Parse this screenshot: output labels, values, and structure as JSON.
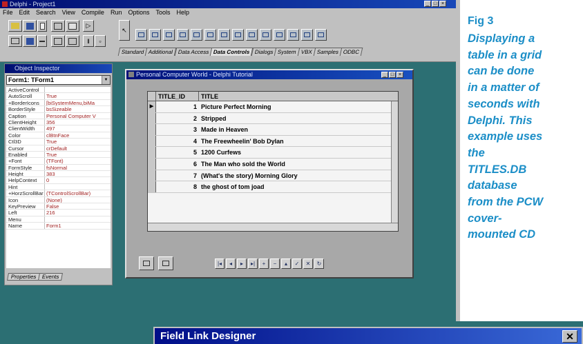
{
  "ide": {
    "title": "Delphi - Project1",
    "menu": [
      "File",
      "Edit",
      "Search",
      "View",
      "Compile",
      "Run",
      "Options",
      "Tools",
      "Help"
    ],
    "palette_tabs": [
      "Standard",
      "Additional",
      "Data Access",
      "Data Controls",
      "Dialogs",
      "System",
      "VBX",
      "Samples",
      "ODBC"
    ],
    "active_tab": "Data Controls"
  },
  "object_inspector": {
    "title": "Object Inspector",
    "combo_value": "Form1: TForm1",
    "properties": [
      {
        "k": "ActiveControl",
        "v": ""
      },
      {
        "k": "AutoScroll",
        "v": "True"
      },
      {
        "k": "+BorderIcons",
        "v": "[biSystemMenu,biMa"
      },
      {
        "k": "BorderStyle",
        "v": "bsSizeable"
      },
      {
        "k": "Caption",
        "v": "Personal Computer V"
      },
      {
        "k": "ClientHeight",
        "v": "356"
      },
      {
        "k": "ClientWidth",
        "v": "497"
      },
      {
        "k": "Color",
        "v": "clBtnFace"
      },
      {
        "k": "Ctl3D",
        "v": "True"
      },
      {
        "k": "Cursor",
        "v": "crDefault"
      },
      {
        "k": "Enabled",
        "v": "True"
      },
      {
        "k": "+Font",
        "v": "(TFont)"
      },
      {
        "k": "FormStyle",
        "v": "fsNormal"
      },
      {
        "k": "Height",
        "v": "383"
      },
      {
        "k": "HelpContext",
        "v": "0"
      },
      {
        "k": "Hint",
        "v": ""
      },
      {
        "k": "+HorzScrollBar",
        "v": "(TControlScrollBar)"
      },
      {
        "k": "Icon",
        "v": "(None)"
      },
      {
        "k": "KeyPreview",
        "v": "False"
      },
      {
        "k": "Left",
        "v": "216"
      },
      {
        "k": "Menu",
        "v": ""
      },
      {
        "k": "Name",
        "v": "Form1"
      }
    ],
    "tabs": [
      "Properties",
      "Events"
    ]
  },
  "form": {
    "title": "Personal Computer World - Delphi Tutorial",
    "grid": {
      "columns": [
        "TITLE_ID",
        "TITLE"
      ],
      "rows": [
        {
          "id": "1",
          "title": "Picture Perfect Morning"
        },
        {
          "id": "2",
          "title": "Stripped"
        },
        {
          "id": "3",
          "title": "Made in Heaven"
        },
        {
          "id": "4",
          "title": "The Freewheelin' Bob Dylan"
        },
        {
          "id": "5",
          "title": "1200 Curfews"
        },
        {
          "id": "6",
          "title": "The Man who sold the World"
        },
        {
          "id": "7",
          "title": "(What's the story) Morning Glory"
        },
        {
          "id": "8",
          "title": "the ghost of tom joad"
        }
      ]
    },
    "navigator": [
      "|◂",
      "◂",
      "▸",
      "▸|",
      "+",
      "−",
      "▴",
      "✓",
      "✕",
      "↻"
    ]
  },
  "sidebar": {
    "fig": "Fig 3",
    "caption": [
      "Displaying a",
      "table in a grid",
      "can be done",
      "in a matter of",
      "seconds with",
      "Delphi. This",
      "example uses",
      "the",
      "TITLES.DB",
      "database",
      "from the PCW",
      "cover-",
      "mounted CD"
    ]
  },
  "dialog": {
    "title": "Field Link Designer",
    "close": "✕"
  }
}
